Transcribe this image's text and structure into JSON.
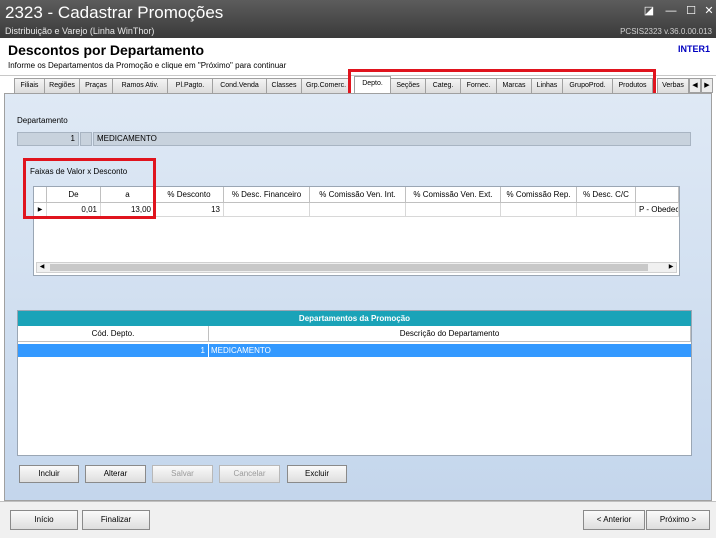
{
  "window": {
    "title": "2323 - Cadastrar Promoções",
    "subtitle": "Distribuição e Varejo (Linha WinThor)",
    "version": "PCSIS2323  v.36.0.00.013"
  },
  "header": {
    "title": "Descontos por Departamento",
    "instruction": "Informe os Departamentos da Promoção e clique em \"Próximo\" para continuar",
    "user_code": "INTER1"
  },
  "tabs": [
    "Filiais",
    "Regiões",
    "Praças",
    "Ramos Ativ.",
    "Pl.Pagto.",
    "Cond.Venda",
    "Classes",
    "Grp.Comerc.",
    "Depto.",
    "Seções",
    "Categ.",
    "Fornec.",
    "Marcas",
    "Linhas",
    "GrupoProd.",
    "Produtos",
    "Verbas"
  ],
  "active_tab": "Depto.",
  "departamento": {
    "label": "Departamento",
    "code": "1",
    "name": "MEDICAMENTO"
  },
  "faixas": {
    "title": "Faixas de Valor x Desconto",
    "columns": [
      "De",
      "a",
      "% Desconto",
      "% Desc. Financeiro",
      "% Comissão Ven. Int.",
      "% Comissão Ven. Ext.",
      "% Comissão Rep.",
      "% Desc. C/C",
      ""
    ],
    "row": [
      "0,01",
      "13,00",
      "13",
      "",
      "",
      "",
      "",
      "",
      "P - Obedec"
    ]
  },
  "departamentos_promocao": {
    "title": "Departamentos da Promoção",
    "columns": [
      "Cód. Depto.",
      "Descrição do Departamento"
    ],
    "rows": [
      [
        "1",
        "MEDICAMENTO"
      ]
    ]
  },
  "actions": {
    "incluir": "Incluir",
    "alterar": "Alterar",
    "salvar": "Salvar",
    "cancelar": "Cancelar",
    "excluir": "Excluir"
  },
  "footer": {
    "inicio": "Início",
    "finalizar": "Finalizar",
    "anterior": "< Anterior",
    "proximo": "Próximo >"
  },
  "colors": {
    "highlight_red": "#e0141e",
    "selection_blue": "#3399ff",
    "panel_title_teal": "#1aa3b8"
  }
}
